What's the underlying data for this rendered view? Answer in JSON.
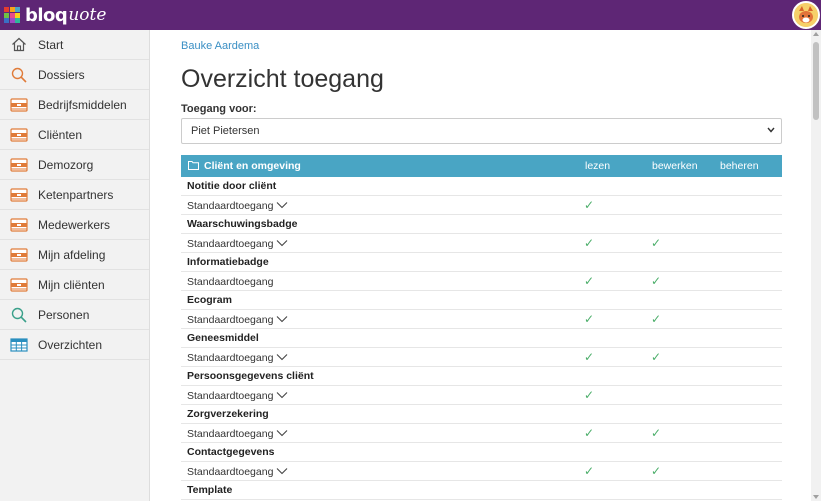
{
  "app": {
    "logo_text": "bloq",
    "logo_script": "uote",
    "logo_colors": [
      "#e63b2e",
      "#f7a21b",
      "#49a5c4",
      "#6fbf44",
      "#e84a8a",
      "#f7d21b",
      "#3b6fc4",
      "#a04ac4",
      "#2fb89a"
    ],
    "topbar_color": "#5e2675",
    "accent": "#49a5c4"
  },
  "sidebar": {
    "items": [
      {
        "label": "Start",
        "icon": "home-icon"
      },
      {
        "label": "Dossiers",
        "icon": "search-icon"
      },
      {
        "label": "Bedrijfsmiddelen",
        "icon": "drawer-icon"
      },
      {
        "label": "Cliënten",
        "icon": "drawer-icon"
      },
      {
        "label": "Demozorg",
        "icon": "drawer-icon"
      },
      {
        "label": "Ketenpartners",
        "icon": "drawer-icon"
      },
      {
        "label": "Medewerkers",
        "icon": "drawer-icon"
      },
      {
        "label": "Mijn afdeling",
        "icon": "drawer-icon"
      },
      {
        "label": "Mijn cliënten",
        "icon": "drawer-icon"
      },
      {
        "label": "Personen",
        "icon": "search-icon"
      },
      {
        "label": "Overzichten",
        "icon": "table-icon"
      }
    ]
  },
  "main": {
    "breadcrumb": "Bauke Aardema",
    "title": "Overzicht toegang",
    "for_label": "Toegang voor:",
    "for_value": "Piet Pietersen"
  },
  "table": {
    "section": "Cliënt en omgeving",
    "col_read": "lezen",
    "col_edit": "bewerken",
    "col_manage": "beheren",
    "check": "✓",
    "groups": [
      {
        "name": "Notitie door cliënt",
        "level": "Standaardtoegang",
        "dropdown": true,
        "read": true,
        "edit": false
      },
      {
        "name": "Waarschuwingsbadge",
        "level": "Standaardtoegang",
        "dropdown": true,
        "read": true,
        "edit": true
      },
      {
        "name": "Informatiebadge",
        "level": "Standaardtoegang",
        "dropdown": false,
        "read": true,
        "edit": true
      },
      {
        "name": "Ecogram",
        "level": "Standaardtoegang",
        "dropdown": true,
        "read": true,
        "edit": true
      },
      {
        "name": "Geneesmiddel",
        "level": "Standaardtoegang",
        "dropdown": true,
        "read": true,
        "edit": true
      },
      {
        "name": "Persoonsgegevens cliënt",
        "level": "Standaardtoegang",
        "dropdown": true,
        "read": true,
        "edit": false
      },
      {
        "name": "Zorgverzekering",
        "level": "Standaardtoegang",
        "dropdown": true,
        "read": true,
        "edit": true
      },
      {
        "name": "Contactgegevens",
        "level": "Standaardtoegang",
        "dropdown": true,
        "read": true,
        "edit": true
      },
      {
        "name": "Template",
        "level": "",
        "dropdown": false,
        "read": false,
        "edit": false
      }
    ]
  }
}
